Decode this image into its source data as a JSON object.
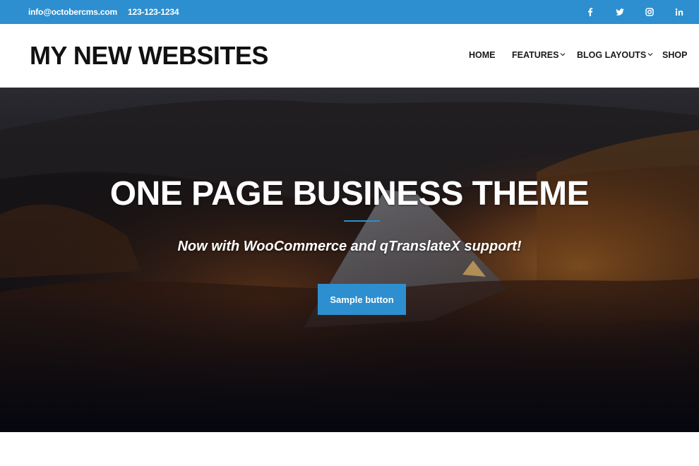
{
  "topbar": {
    "email": "info@octobercms.com",
    "phone": "123-123-1234",
    "social": [
      "facebook-icon",
      "twitter-icon",
      "instagram-icon",
      "linkedin-icon"
    ],
    "background": "#2d8fcf"
  },
  "header": {
    "logo": "MY NEW WEBSITES",
    "nav": [
      {
        "label": "HOME",
        "dropdown": false
      },
      {
        "label": "FEATURES",
        "dropdown": true
      },
      {
        "label": "BLOG LAYOUTS",
        "dropdown": true
      },
      {
        "label": "SHOP",
        "dropdown": false
      }
    ]
  },
  "hero": {
    "title": "ONE PAGE BUSINESS THEME",
    "subtitle": "Now with WooCommerce and qTranslateX support!",
    "button_label": "Sample button",
    "accent": "#2d8fcf"
  }
}
